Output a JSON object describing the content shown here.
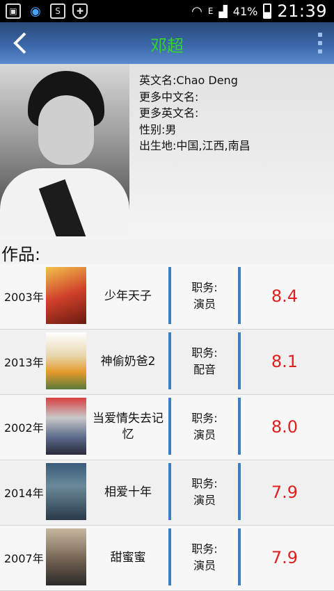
{
  "status_bar": {
    "battery": "41%",
    "time": "21:39",
    "network": "E",
    "icons": [
      "gallery-icon",
      "qq-icon",
      "sim-icon",
      "shield-icon",
      "wifi-icon",
      "signal-icon",
      "battery-icon"
    ]
  },
  "appbar": {
    "title": "邓超",
    "title_color": "#33d233",
    "back_icon": "chevron-left-icon",
    "menu_icon": "overflow-menu-icon"
  },
  "profile": {
    "english_name": "英文名:Chao Deng",
    "more_chinese_names": "更多中文名:",
    "more_english_names": "更多英文名:",
    "gender": "性别:男",
    "birthplace": "出生地:中国,江西,南昌"
  },
  "works": {
    "heading": "作品:",
    "items": [
      {
        "year": "2003年",
        "title": "少年天子",
        "role_label": "职务:",
        "role": "演员",
        "score": "8.4"
      },
      {
        "year": "2013年",
        "title": "神偷奶爸2",
        "role_label": "职务:",
        "role": "配音",
        "score": "8.1"
      },
      {
        "year": "2002年",
        "title": "当爱情失去记忆",
        "role_label": "职务:",
        "role": "演员",
        "score": "8.0"
      },
      {
        "year": "2014年",
        "title": "相爱十年",
        "role_label": "职务:",
        "role": "演员",
        "score": "7.9"
      },
      {
        "year": "2007年",
        "title": "甜蜜蜜",
        "role_label": "职务:",
        "role": "演员",
        "score": "7.9"
      }
    ]
  },
  "colors": {
    "accent_bar": "#3a7fc4",
    "score": "#e02020"
  }
}
